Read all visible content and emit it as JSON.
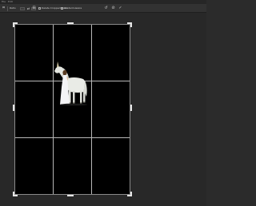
{
  "menubar": {
    "items": [
      "File",
      "Edit",
      "Image",
      "Layer",
      "Type",
      "Select",
      "Filter",
      "3D",
      "View",
      "Window",
      "Help"
    ]
  },
  "options": {
    "tool_icon": "crop-icon",
    "ratio_label": "Ratio",
    "straighten_label": "Straighten",
    "delete_pixels_label": "Delete Cropped Pixels",
    "content_aware_label": "Content-Aware",
    "reset_icon": "reset-icon",
    "cancel_icon": "cancel-icon",
    "commit_icon": "check-icon"
  },
  "canvas": {
    "background": "#000000",
    "overlay": "rule-of-thirds",
    "subject": "woman in white dress with white unicorn"
  },
  "colors": {
    "app_bg": "#2b2b2b",
    "grid": "#b8b8b8",
    "handle": "#e6e6e6"
  }
}
